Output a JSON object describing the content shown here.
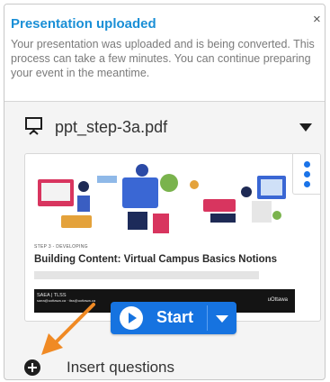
{
  "notification": {
    "title": "Presentation uploaded",
    "close_glyph": "×",
    "message": "Your presentation was uploaded and is being converted. This process can take a few minutes. You can continue preparing your event in the meantime."
  },
  "file": {
    "icon": "presentation-screen-icon",
    "name": "ppt_step-3a.pdf",
    "toggle_icon": "caret-down-icon"
  },
  "slide": {
    "step_label": "STEP 3 - DEVELOPING",
    "title": "Building Content: Virtual Campus Basics Notions",
    "footer_left": "SAEA | TLSS",
    "footer_left_sub": "saea@uottawa.ca  ·  tlss@uottawa.ca",
    "footer_right": "uOttawa",
    "menu_icon": "kebab-menu-icon"
  },
  "start_button": {
    "label": "Start",
    "icon": "play-icon",
    "dropdown_icon": "caret-down-icon"
  },
  "insert": {
    "icon": "plus-circle-icon",
    "label": "Insert questions"
  },
  "colors": {
    "accent": "#1673e0",
    "title_blue": "#1a8fd6",
    "annotation_arrow": "#f08a24"
  }
}
